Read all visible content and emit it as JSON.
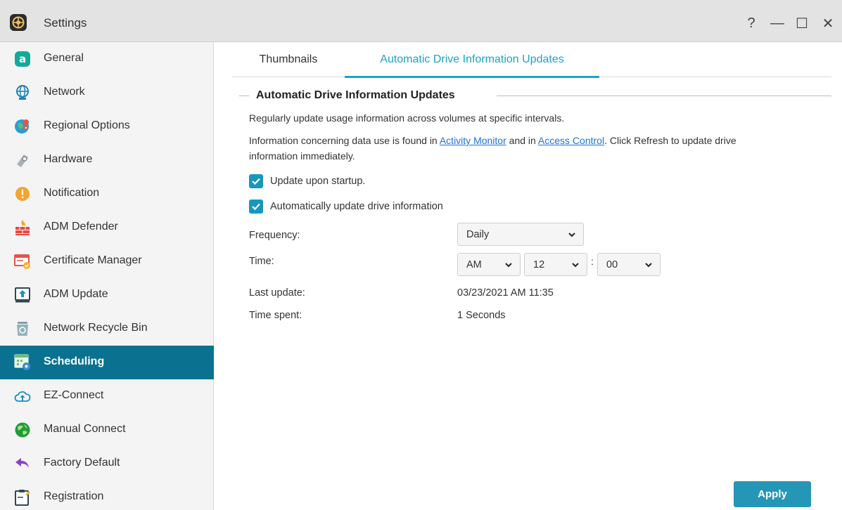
{
  "window": {
    "title": "Settings",
    "controls": {
      "help": "?",
      "minimize": "—",
      "maximize": "☐",
      "close": "✕"
    }
  },
  "sidebar": {
    "items": [
      {
        "label": "General",
        "icon": "general-icon"
      },
      {
        "label": "Network",
        "icon": "globe-icon"
      },
      {
        "label": "Regional Options",
        "icon": "regional-options-icon"
      },
      {
        "label": "Hardware",
        "icon": "hardware-icon"
      },
      {
        "label": "Notification",
        "icon": "notification-icon"
      },
      {
        "label": "ADM Defender",
        "icon": "firewall-icon"
      },
      {
        "label": "Certificate Manager",
        "icon": "certificate-icon"
      },
      {
        "label": "ADM Update",
        "icon": "update-icon"
      },
      {
        "label": "Network Recycle Bin",
        "icon": "recycle-bin-icon"
      },
      {
        "label": "Scheduling",
        "icon": "scheduling-icon",
        "active": true
      },
      {
        "label": "EZ-Connect",
        "icon": "cloud-upload-icon"
      },
      {
        "label": "Manual Connect",
        "icon": "manual-connect-icon"
      },
      {
        "label": "Factory Default",
        "icon": "undo-icon"
      },
      {
        "label": "Registration",
        "icon": "registration-icon"
      }
    ]
  },
  "tabs": [
    {
      "label": "Thumbnails"
    },
    {
      "label": "Automatic Drive Information Updates",
      "active": true
    }
  ],
  "section": {
    "title": "Automatic Drive Information Updates",
    "desc1": "Regularly update usage information across volumes at specific intervals.",
    "desc2_prefix": "Information concerning data use is found in ",
    "link_activity": "Activity Monitor",
    "desc2_mid": " and in ",
    "link_access": "Access Control",
    "desc2_suffix": ". Click Refresh to update drive",
    "desc3": "information immediately."
  },
  "options": {
    "update_on_startup": {
      "label": "Update upon startup.",
      "checked": true
    },
    "auto_update": {
      "label": "Automatically update drive information",
      "checked": true
    }
  },
  "form": {
    "frequency_label": "Frequency:",
    "frequency_value": "Daily",
    "time_label": "Time:",
    "time_ampm": "AM",
    "time_hour": "12",
    "time_colon": ":",
    "time_minute": "00",
    "last_update_label": "Last update:",
    "last_update_value": "03/23/2021 AM 11:35",
    "time_spent_label": "Time spent:",
    "time_spent_value": "1 Seconds"
  },
  "apply_label": "Apply",
  "colors": {
    "accent": "#1ba3c6",
    "sidebar_active": "#0a7290",
    "checkbox": "#1897bd",
    "apply_button": "#2596b6",
    "link": "#1a73d9"
  }
}
